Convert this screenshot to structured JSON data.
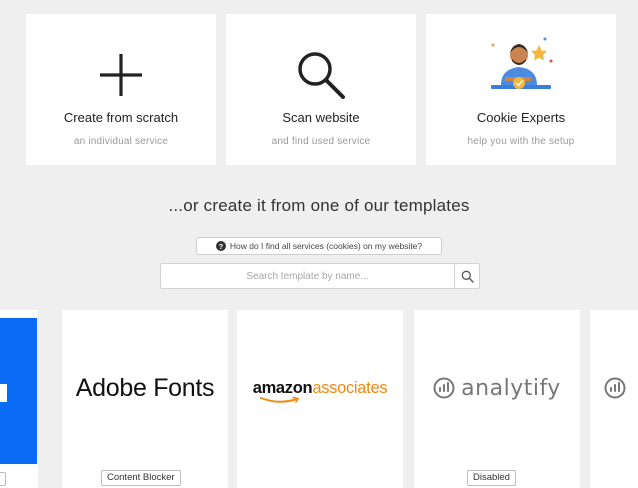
{
  "options": [
    {
      "title": "Create from scratch",
      "subtitle": "an individual service",
      "icon": "plus-icon"
    },
    {
      "title": "Scan website",
      "subtitle": "and find used service",
      "icon": "magnifier-icon"
    },
    {
      "title": "Cookie Experts",
      "subtitle": "help you with the setup",
      "icon": "expert-illustration"
    }
  ],
  "heading": "...or create it from one of our templates",
  "help_link": "How do I find all services (cookies) on my website?",
  "search": {
    "placeholder": "Search template by name..."
  },
  "templates": [
    {
      "name": "",
      "badge": ""
    },
    {
      "name": "Adobe Fonts",
      "badge": "Content Blocker"
    },
    {
      "name_part1": "amazon",
      "name_part2": "associates",
      "badge": ""
    },
    {
      "name": "analytify",
      "badge": "Disabled"
    },
    {
      "name": "",
      "badge": ""
    }
  ],
  "colors": {
    "accent_blue": "#0a6cf5",
    "amazon_orange": "#f08a12",
    "background": "#efefef"
  }
}
